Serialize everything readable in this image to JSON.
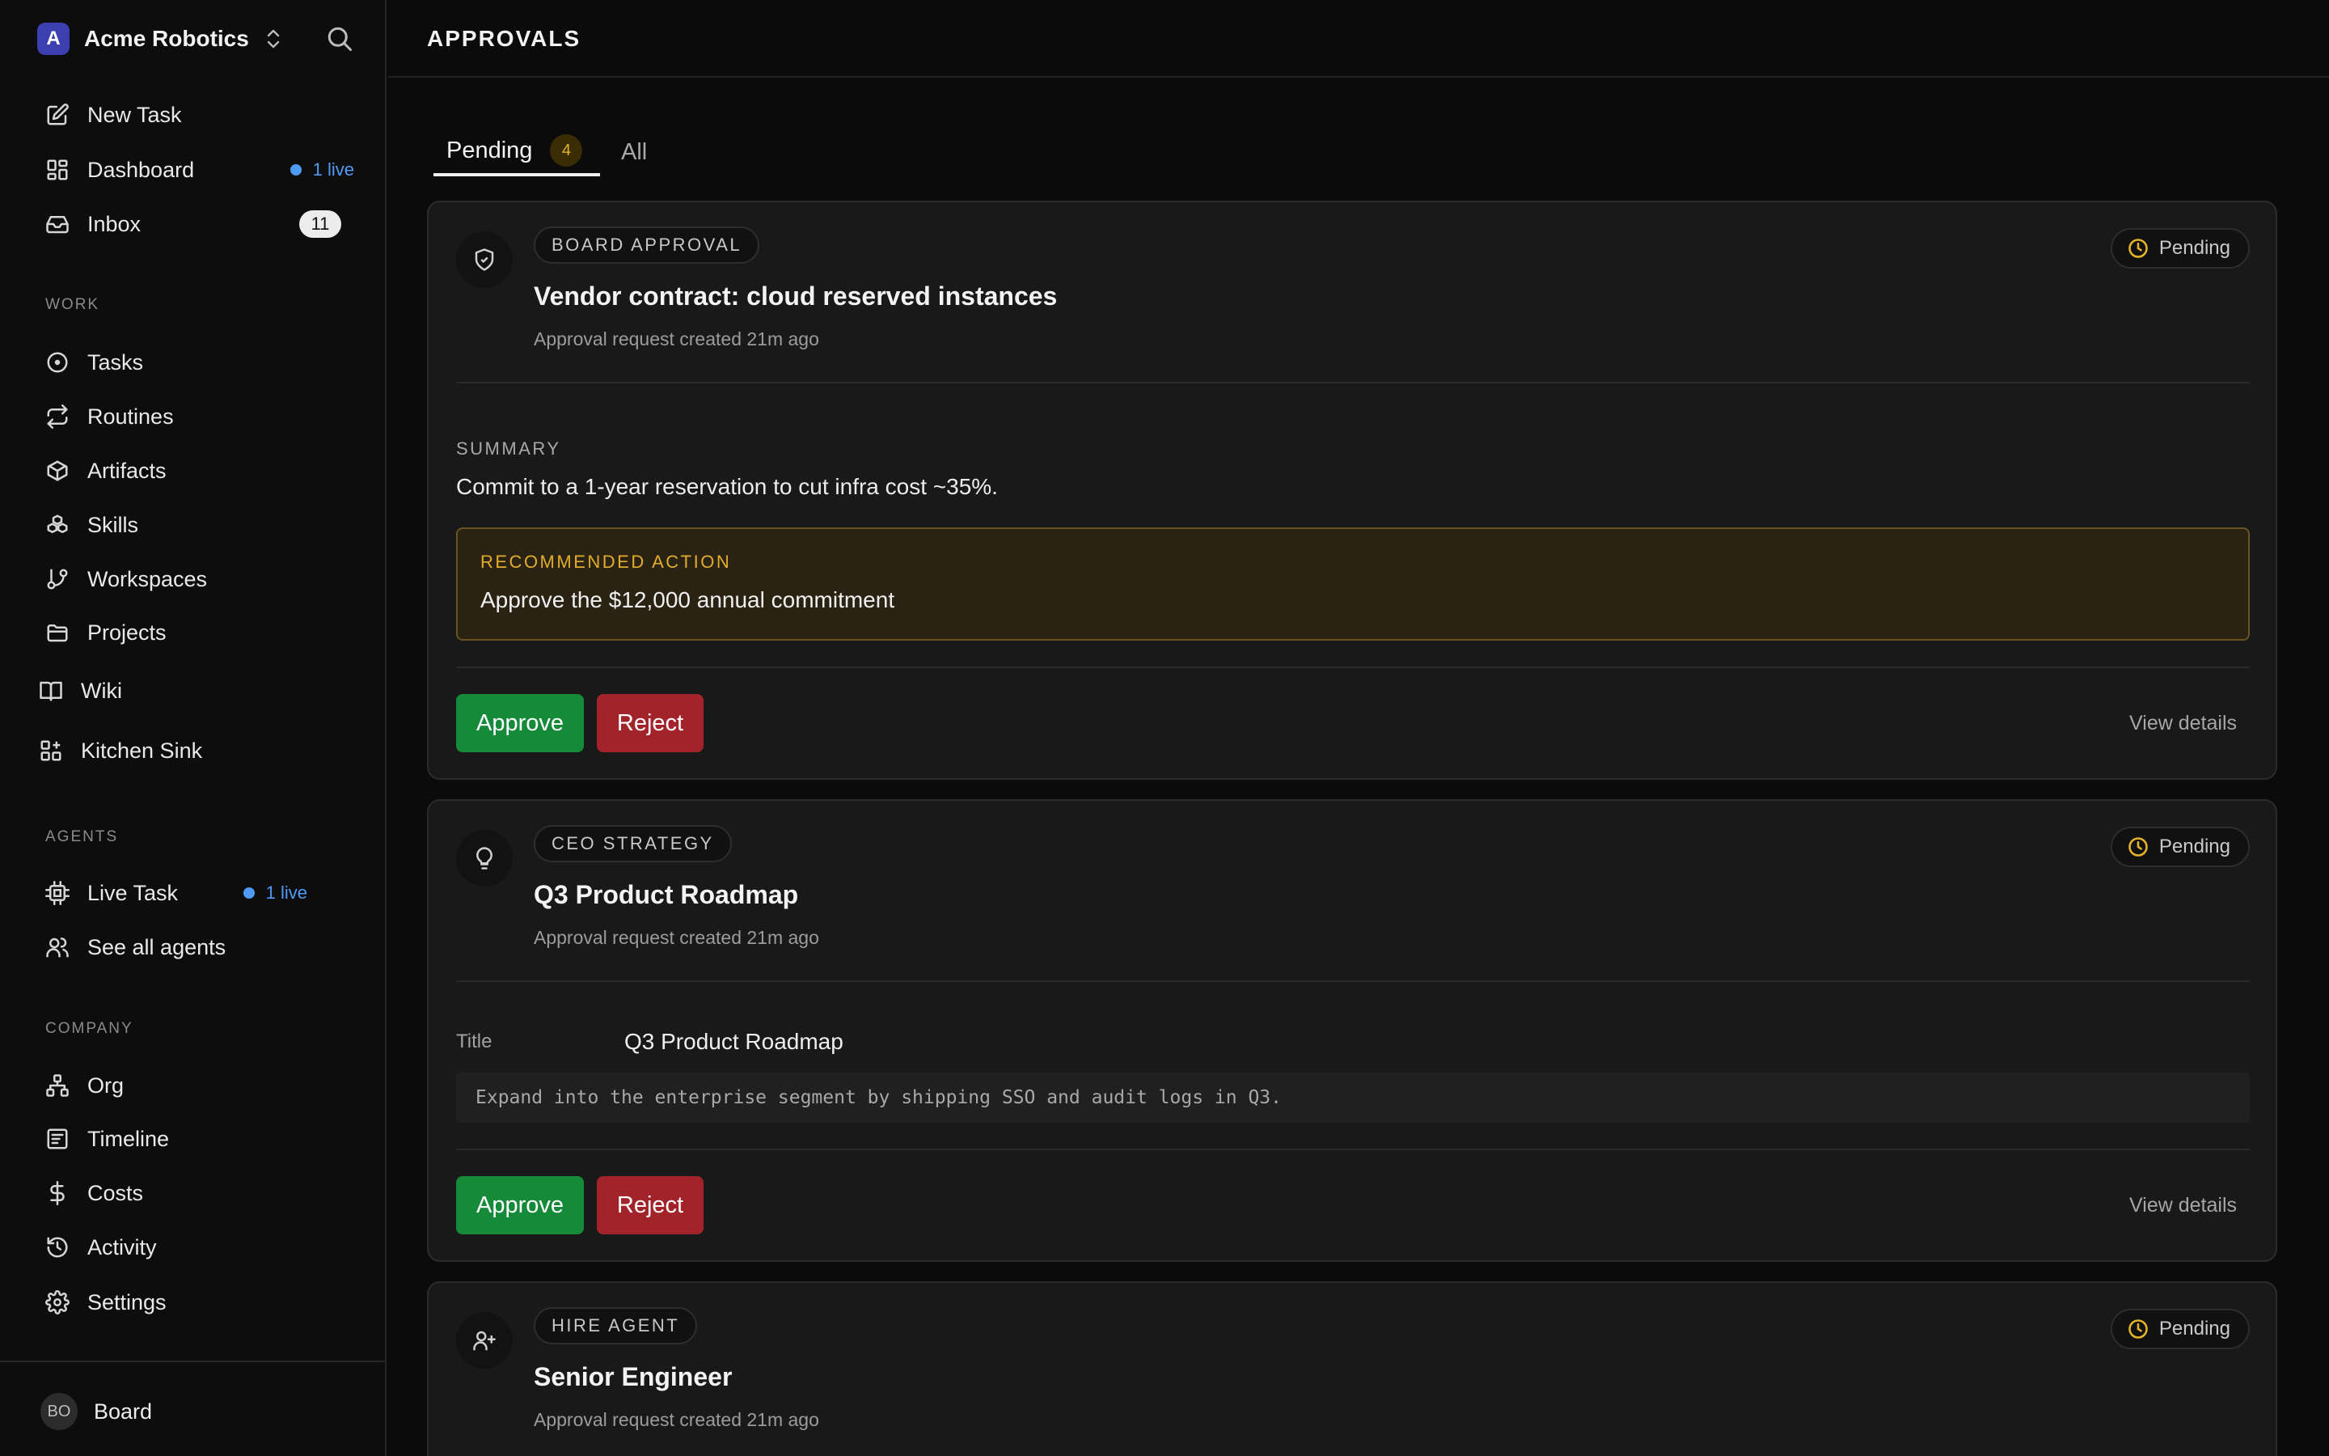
{
  "workspace": {
    "name": "Acme Robotics",
    "logo_letter": "A"
  },
  "nav": {
    "top": [
      {
        "label": "New Task",
        "icon": "edit-icon"
      },
      {
        "label": "Dashboard",
        "icon": "dashboard-icon",
        "live": "1 live"
      },
      {
        "label": "Inbox",
        "icon": "inbox-icon",
        "count": "11"
      }
    ],
    "work_header": "WORK",
    "work": [
      {
        "label": "Tasks",
        "icon": "circle-dot-icon"
      },
      {
        "label": "Routines",
        "icon": "repeat-icon"
      },
      {
        "label": "Artifacts",
        "icon": "box-icon"
      },
      {
        "label": "Skills",
        "icon": "boxes-icon"
      },
      {
        "label": "Workspaces",
        "icon": "git-branch-icon"
      },
      {
        "label": "Projects",
        "icon": "folder-icon"
      },
      {
        "label": "Wiki",
        "icon": "book-icon"
      },
      {
        "label": "Kitchen Sink",
        "icon": "grid-plus-icon"
      }
    ],
    "agents_header": "AGENTS",
    "agents": [
      {
        "label": "Live Task",
        "icon": "cpu-icon",
        "live": "1 live"
      },
      {
        "label": "See all agents",
        "icon": "users-icon"
      }
    ],
    "company_header": "COMPANY",
    "company": [
      {
        "label": "Org",
        "icon": "org-chart-icon"
      },
      {
        "label": "Timeline",
        "icon": "timeline-icon"
      },
      {
        "label": "Costs",
        "icon": "dollar-icon"
      },
      {
        "label": "Activity",
        "icon": "history-icon"
      },
      {
        "label": "Settings",
        "icon": "gear-icon"
      }
    ]
  },
  "user": {
    "initials": "BO",
    "name": "Board"
  },
  "page": {
    "title": "APPROVALS"
  },
  "tabs": [
    {
      "label": "Pending",
      "count": "4",
      "active": true
    },
    {
      "label": "All"
    }
  ],
  "cards": [
    {
      "type": "BOARD APPROVAL",
      "icon": "shield-check-icon",
      "title": "Vendor contract: cloud reserved instances",
      "subtitle": "Approval request created 21m ago",
      "status": "Pending",
      "summary_label": "SUMMARY",
      "summary": "Commit to a 1-year reservation to cut infra cost ~35%.",
      "recommended_label": "RECOMMENDED ACTION",
      "recommended": "Approve the $12,000 annual commitment",
      "approve": "Approve",
      "reject": "Reject",
      "view_details": "View details"
    },
    {
      "type": "CEO STRATEGY",
      "icon": "lightbulb-icon",
      "title": "Q3 Product Roadmap",
      "subtitle": "Approval request created 21m ago",
      "status": "Pending",
      "field_label": "Title",
      "field_value": "Q3 Product Roadmap",
      "detail": "Expand into the enterprise segment by shipping SSO and audit logs in Q3.",
      "approve": "Approve",
      "reject": "Reject",
      "view_details": "View details"
    },
    {
      "type": "HIRE AGENT",
      "icon": "user-plus-icon",
      "title": "Senior Engineer",
      "subtitle": "Approval request created 21m ago",
      "status": "Pending"
    }
  ],
  "colors": {
    "approve": "#158a39",
    "reject": "#a3232a",
    "pending_accent": "#e5b42a",
    "live": "#4e9bf5"
  }
}
